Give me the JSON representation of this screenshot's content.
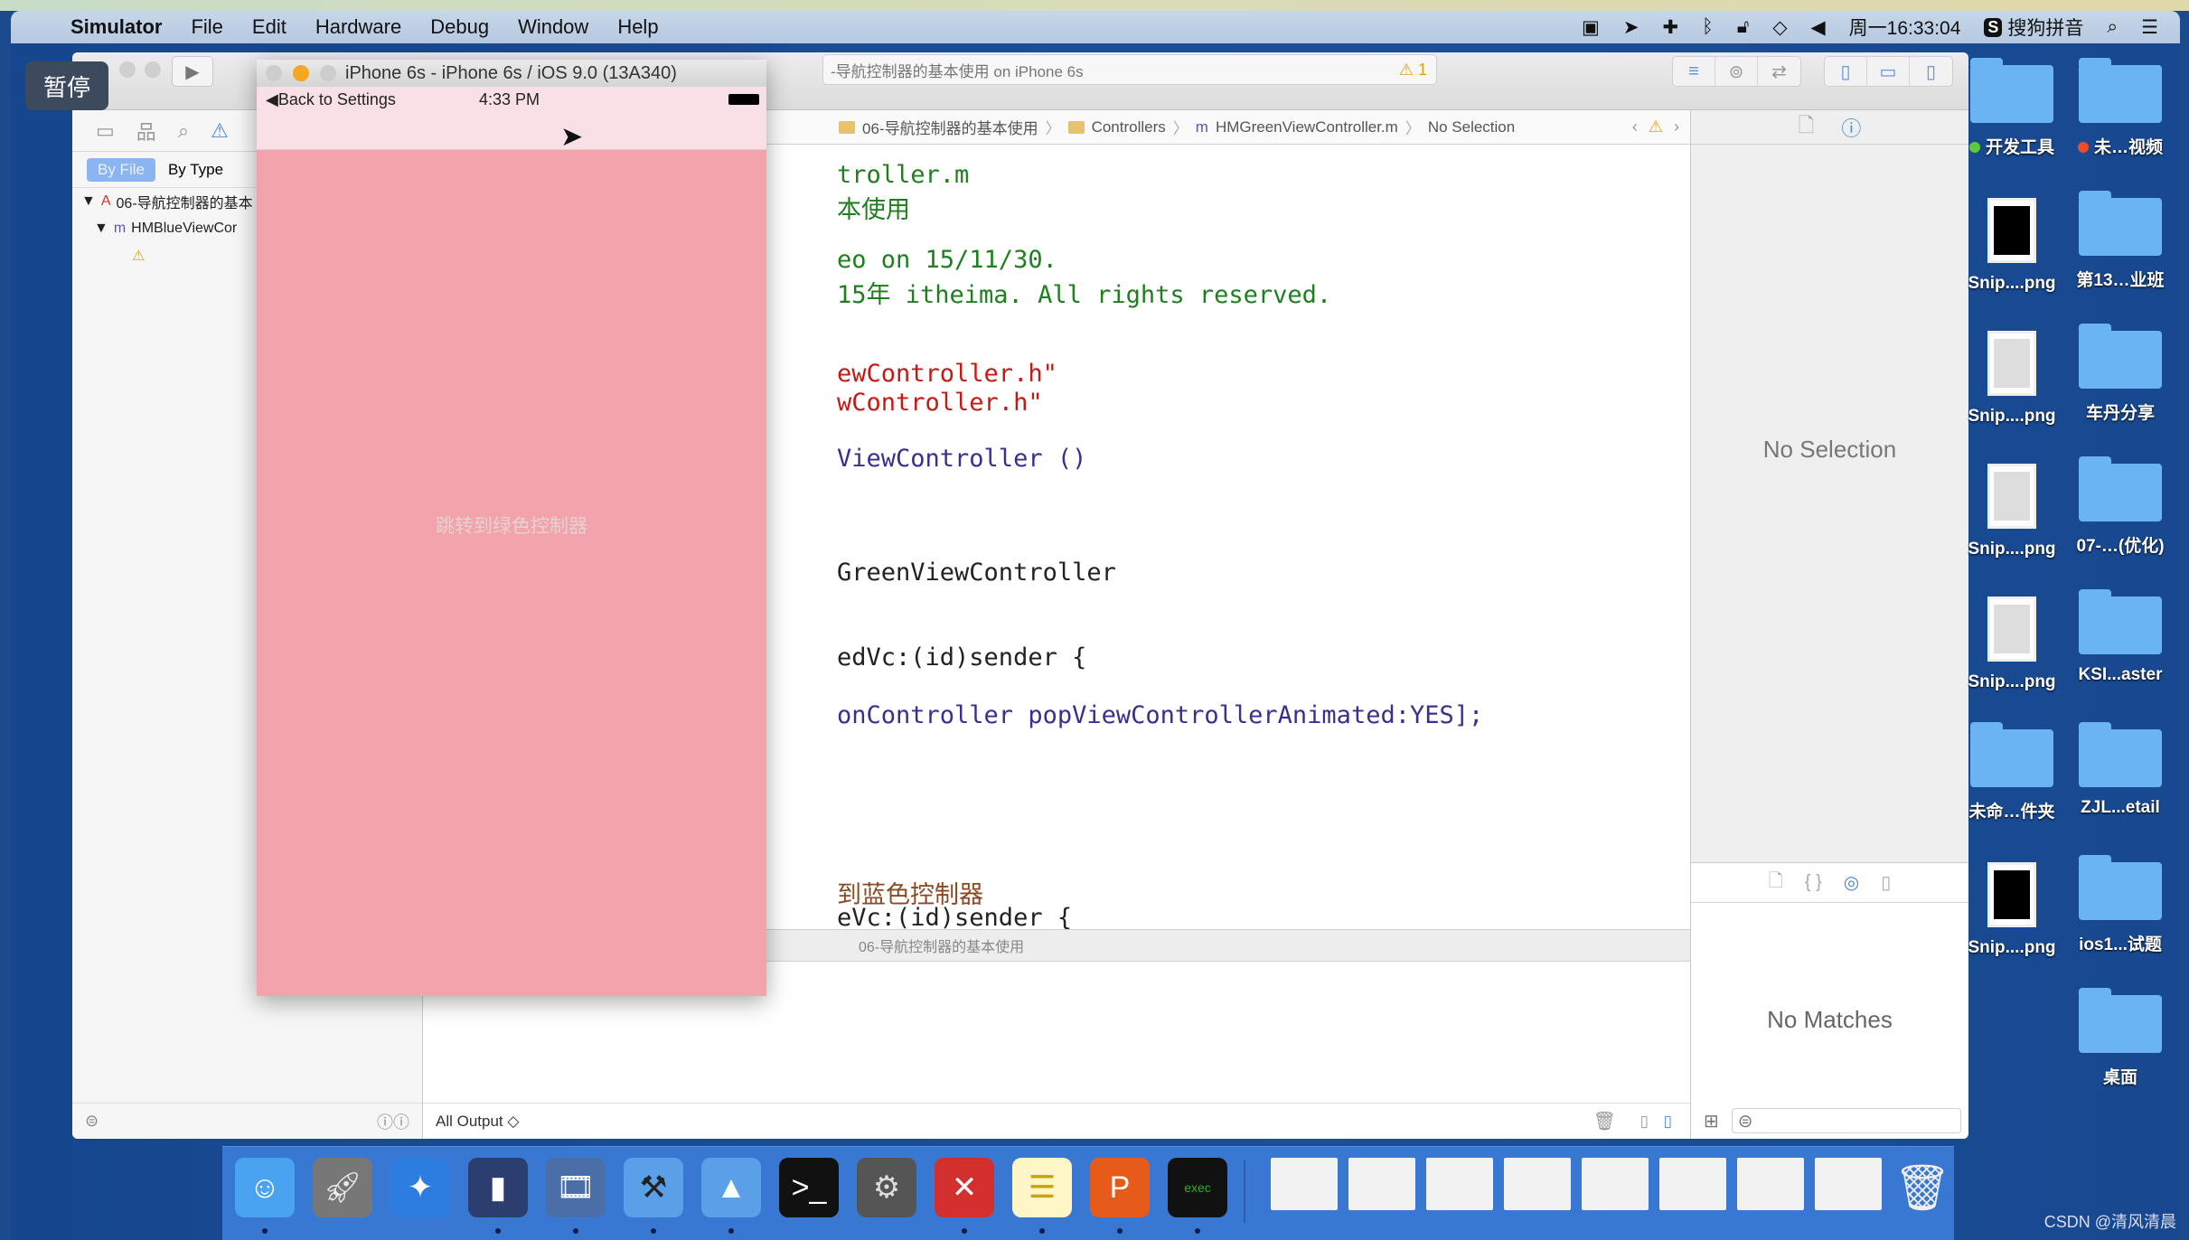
{
  "menubar": {
    "app_name": "Simulator",
    "items": [
      "File",
      "Edit",
      "Hardware",
      "Debug",
      "Window",
      "Help"
    ],
    "clock": "周一16:33:04",
    "input_method": "搜狗拼音",
    "input_method_badge": "S"
  },
  "overlay": {
    "pause_label": "暂停"
  },
  "xcode": {
    "status_text": "-导航控制器的基本使用 on iPhone 6s",
    "warning_count": "1",
    "navigator": {
      "scope_tabs": [
        "By File",
        "By Type"
      ],
      "tree": [
        {
          "label": "06-导航控制器的基本",
          "level": 0
        },
        {
          "label": "HMBlueViewCor",
          "level": 1
        }
      ]
    },
    "jumpbar": [
      "06-导航控制器的基本使用",
      "Controllers",
      "HMGreenViewController.m",
      "No Selection"
    ],
    "code_lines": [
      {
        "text": "troller.m",
        "cls": "cmt"
      },
      {
        "text": "本使用",
        "cls": "cmt"
      },
      {
        "text": "eo on 15/11/30.",
        "cls": "cmt"
      },
      {
        "text": "15年 itheima. All rights reserved.",
        "cls": "cmt"
      },
      {
        "text": "ewController.h\"",
        "cls": "str"
      },
      {
        "text": "wController.h\"",
        "cls": "str"
      },
      {
        "text": "ViewController ()",
        "cls": "cls"
      },
      {
        "text": "GreenViewController",
        "cls": ""
      },
      {
        "text": "edVc:(id)sender {",
        "cls": ""
      },
      {
        "text": "onController popViewControllerAnimated:YES];",
        "cls": "cls"
      },
      {
        "text": "到蓝色控制器",
        "cls": "cmt2"
      },
      {
        "text": "eVc:(id)sender {",
        "cls": ""
      }
    ],
    "breakpoint_bar_label": "06-导航控制器的基本使用",
    "debug_output_selector": "All Output ◇",
    "inspector_empty": "No Selection",
    "library_empty": "No Matches"
  },
  "simulator": {
    "window_title": "iPhone 6s - iPhone 6s / iOS 9.0 (13A340)",
    "back_label": "Back to Settings",
    "time": "4:33 PM",
    "center_button_label": "跳转到绿色控制器",
    "colors": {
      "nav_bg": "#f8e0e6",
      "body_bg": "#f2a3ab"
    }
  },
  "desktop_icons": [
    {
      "label": "开发工具",
      "type": "folder",
      "tag": "green"
    },
    {
      "label": "未…视频",
      "type": "folder",
      "tag": "red"
    },
    {
      "label": "Snip....png",
      "type": "thumb"
    },
    {
      "label": "第13…业班",
      "type": "folder"
    },
    {
      "label": "Snip....png",
      "type": "thumb-light"
    },
    {
      "label": "车丹分享",
      "type": "folder"
    },
    {
      "label": "Snip....png",
      "type": "thumb-light"
    },
    {
      "label": "07-…(优化)",
      "type": "folder"
    },
    {
      "label": "Snip....png",
      "type": "thumb-light"
    },
    {
      "label": "KSI...aster",
      "type": "folder"
    },
    {
      "label": "未命…件夹",
      "type": "folder"
    },
    {
      "label": "ZJL...etail",
      "type": "folder"
    },
    {
      "label": "Snip....png",
      "type": "thumb"
    },
    {
      "label": "ios1...试题",
      "type": "folder"
    },
    {
      "label": "桌面",
      "type": "folder"
    }
  ],
  "dock": {
    "apps": [
      "finder",
      "launchpad",
      "safari",
      "mouse-app",
      "movie-app",
      "xcode",
      "instruments",
      "terminal",
      "system-preferences",
      "xmind",
      "notes",
      "powerpoint",
      "console"
    ],
    "minimized_count": 8,
    "trash": "trash"
  },
  "watermark": "CSDN @清风清晨"
}
